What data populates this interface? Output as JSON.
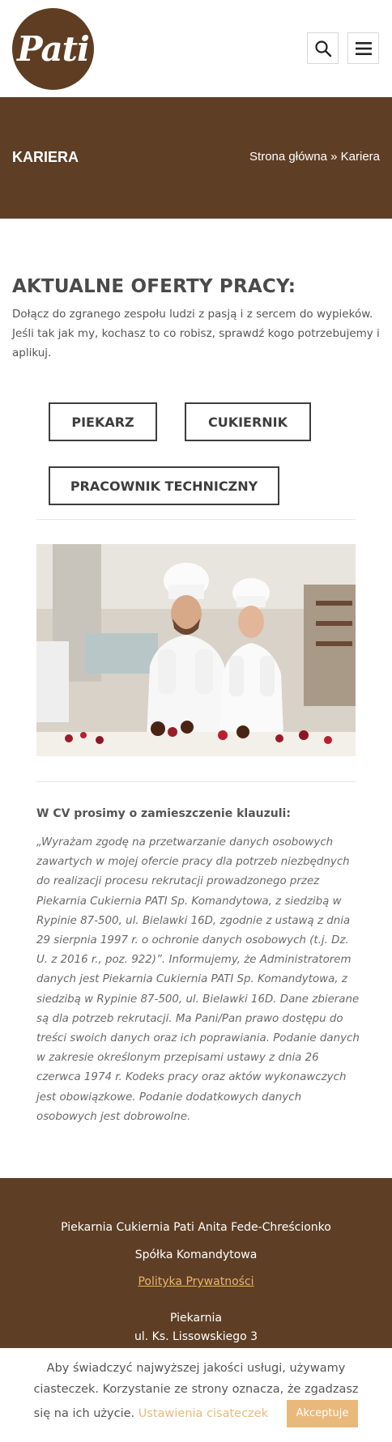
{
  "header": {
    "logo_text": "Pati",
    "search_icon": "search-icon",
    "menu_icon": "hamburger-menu-icon"
  },
  "banner": {
    "title": "KARIERA",
    "breadcrumb_home": "Strona główna",
    "breadcrumb_sep": "»",
    "breadcrumb_current": "Kariera"
  },
  "main": {
    "heading": "AKTUALNE OFERTY PRACY:",
    "intro": "Dołącz do zgranego zespołu ludzi z pasją i z sercem do wypieków. Jeśli tak jak my, kochasz to co robisz, sprawdź kogo potrzebujemy i aplikuj.",
    "jobs": [
      "PIEKARZ",
      "CUKIERNIK",
      "PRACOWNIK TECHNICZNY"
    ],
    "clause_title": "W CV prosimy o zamieszczenie klauzuli:",
    "clause_text": "„Wyrażam zgodę na przetwarzanie danych osobowych zawartych w mojej ofercie pracy dla potrzeb niezbędnych do realizacji procesu rekrutacji prowadzonego przez Piekarnia Cukiernia PATI Sp. Komandytowa, z siedzibą w Rypinie 87-500, ul. Bielawki 16D, zgodnie z ustawą z dnia 29 sierpnia 1997 r. o ochronie danych osobowych (t.j. Dz. U. z 2016 r., poz. 922)”. Informujemy, że Administratorem danych jest Piekarnia Cukiernia PATI Sp. Komandytowa, z siedzibą w Rypinie 87-500, ul. Bielawki 16D. Dane zbierane są dla potrzeb rekrutacji. Ma Pani/Pan prawo dostępu do treści swoich danych oraz ich poprawiania. Podanie danych w zakresie określonym przepisami ustawy z dnia 26 czerwca 1974 r. Kodeks pracy oraz aktów wykonawczych jest obowiązkowe. Podanie dodatkowych danych osobowych jest dobrowolne."
  },
  "footer": {
    "company_line1": "Piekarnia Cukiernia Pati Anita Fede-Chreścionko",
    "company_line2": "Spółka Komandytowa",
    "privacy_link": "Polityka Prywatności",
    "bakery_label": "Piekarnia",
    "address": "ul. Ks. Lissowskiego 3"
  },
  "cookie": {
    "text": "Aby świadczyć najwyższej jakości usługi, używamy ciasteczek. Korzystanie ze strony oznacza, że zgadzasz się na ich użycie.",
    "settings_label": "Ustawienia cisateczek",
    "accept_label": "Akceptuje"
  },
  "colors": {
    "brand_brown": "#5e3f26",
    "accent_gold": "#e9b97c",
    "link_gold": "#e9b563"
  }
}
